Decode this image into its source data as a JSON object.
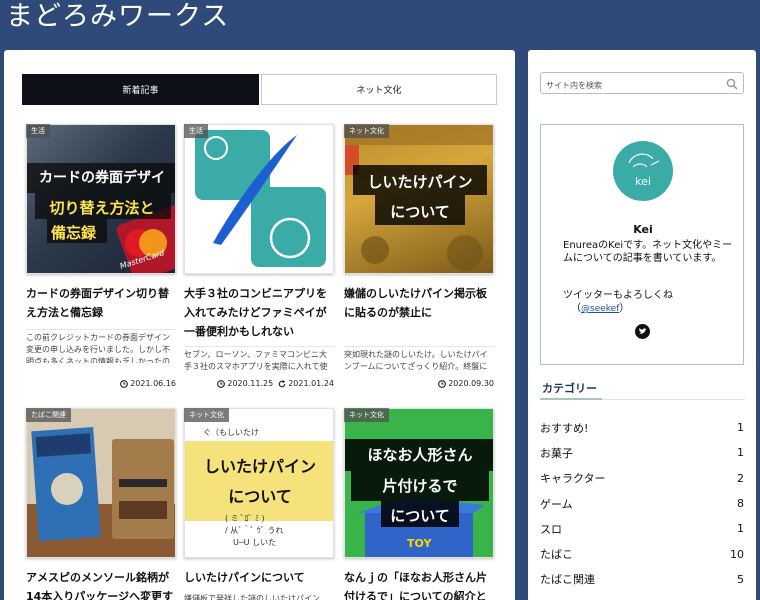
{
  "site": {
    "title": "まどろみワークス"
  },
  "tabs": [
    {
      "label": "新着記事"
    },
    {
      "label": "ネット文化"
    }
  ],
  "articles": [
    {
      "category": "生活",
      "thumb_text": [
        "カードの券面デザイ",
        "切り替え方法と",
        "備忘録"
      ],
      "thumb_brand": "MasterCard",
      "title": "カードの券面デザイン切り替え方法と備忘録",
      "desc": "この前クレジットカードの券面デザイン変更の申し込みを行いました。しかし不明点も多くネットの情報も乏しかったので、備忘録を",
      "date": "2021.06.16",
      "updated": ""
    },
    {
      "category": "生活",
      "thumb_text": [],
      "title": "大手３社のコンビニアプリを入れてみたけどファミペイが一番便利かもしれない",
      "desc": "セブン、ローソン、ファミマコンビニ大手３社のスマホアプリを実際に入れて使ってみたので一番便利なものを",
      "date": "2020.11.25",
      "updated": "2021.01.24"
    },
    {
      "category": "ネット文化",
      "thumb_text": [
        "しいたけパイン",
        "について"
      ],
      "title": "嫌儲のしいたけパイン掲示板に貼るのが禁止に",
      "desc": "突如現れた謎のしいたけ。しいたけパインブームについてざっくり紹介。終盤にVIPやなんJその他板にも波及しました",
      "date": "2020.09.30",
      "updated": ""
    },
    {
      "category": "たばこ関連",
      "thumb_text": [],
      "title": "アメスピのメンソール銘柄が14本入りパッケージへ変更す",
      "desc": "",
      "date": "",
      "updated": ""
    },
    {
      "category": "ネット文化",
      "thumb_text": [
        "しいたけパイン",
        "について"
      ],
      "thumb_ascii": [
        "ぐ（もしいたけ",
        "( ミ ﾟﾛﾟ ﾐ )",
        "/ 从ﾞ＾ﾟ ｳﾞ  うれ",
        "U─U  しいた"
      ],
      "title": "しいたけパインについて",
      "desc": "嫌儲板で発祥した謎のしいたけパイン",
      "date": "",
      "updated": ""
    },
    {
      "category": "ネット文化",
      "thumb_text": [
        "ほなお人形さん",
        "片付けるで",
        "について"
      ],
      "thumb_box": "TOY",
      "title": "なんｊの「ほなお人形さん片付けるで」についての紹介と",
      "desc": "",
      "date": "",
      "updated": ""
    }
  ],
  "sidebar": {
    "search_placeholder": "サイト内を検索",
    "profile": {
      "avatar_text": "kei",
      "name": "Kei",
      "bio": "EnureaのKeiです。ネット文化やミームについての記事を書いています。",
      "twitter_prefix": "ツイッターもよろしくね",
      "twitter_handle": "@seekef"
    },
    "category_heading": "カテゴリー",
    "categories": [
      {
        "name": "おすすめ!",
        "count": "1"
      },
      {
        "name": "お菓子",
        "count": "1"
      },
      {
        "name": "キャラクター",
        "count": "2"
      },
      {
        "name": "ゲーム",
        "count": "8"
      },
      {
        "name": "スロ",
        "count": "1"
      },
      {
        "name": "たばこ",
        "count": "10"
      },
      {
        "name": "たばこ関連",
        "count": "5"
      }
    ]
  },
  "colors": {
    "header_bg": "#2e4a78",
    "tab_active": "#0d1117",
    "accent_teal": "#3aaba6",
    "link": "#1a4fb0"
  }
}
